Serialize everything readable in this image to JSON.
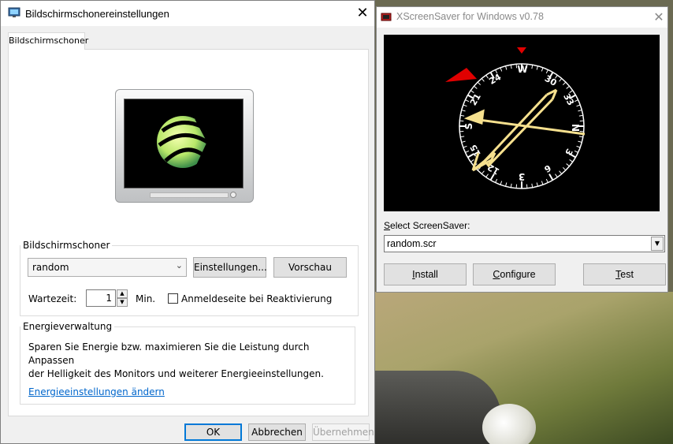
{
  "main_window": {
    "title": "Bildschirmschonereinstellungen",
    "close_glyph": "✕",
    "tab_label": "Bildschirmschoner",
    "screensaver_group": {
      "legend": "Bildschirmschoner",
      "selected": "random",
      "settings_label": "Einstellungen...",
      "preview_label": "Vorschau",
      "wait_label": "Wartezeit:",
      "wait_value": "1",
      "min_label": "Min.",
      "resume_label": "Anmeldeseite bei Reaktivierung",
      "resume_checked": false
    },
    "power_group": {
      "legend": "Energieverwaltung",
      "description_line1": "Sparen Sie Energie bzw. maximieren Sie die Leistung durch Anpassen",
      "description_line2": "der Helligkeit des Monitors und weiterer Energieeinstellungen.",
      "link": "Energieeinstellungen ändern"
    },
    "buttons": {
      "ok": "OK",
      "cancel": "Abbrechen",
      "apply": "Übernehmen"
    }
  },
  "xscreensaver_window": {
    "title": "XScreenSaver for Windows v0.78",
    "close_glyph": "✕",
    "select_label_mnemonic": "S",
    "select_label_rest": "elect ScreenSaver:",
    "selected": "random.scr",
    "buttons": {
      "install_mnemonic": "I",
      "install_rest": "nstall",
      "configure_mnemonic": "C",
      "configure_rest": "onfigure",
      "test_mnemonic": "T",
      "test_rest": "est"
    },
    "compass_labels": {
      "north": "W",
      "n30": "30",
      "n33": "33",
      "east": "N",
      "e3": "3",
      "e6": "6",
      "south": "3",
      "s12": "12",
      "s15": "15",
      "west": "S",
      "w21": "21",
      "w24": "24"
    }
  },
  "colors": {
    "compass_needle": "#f6e08e",
    "compass_red": "#e00000",
    "link_blue": "#0066cc",
    "focus_blue": "#0078d7"
  },
  "icons": [
    "screensaver-icon",
    "xscreensaver-icon",
    "close-icon",
    "chevron-down-icon",
    "spin-up-icon",
    "spin-down-icon"
  ]
}
